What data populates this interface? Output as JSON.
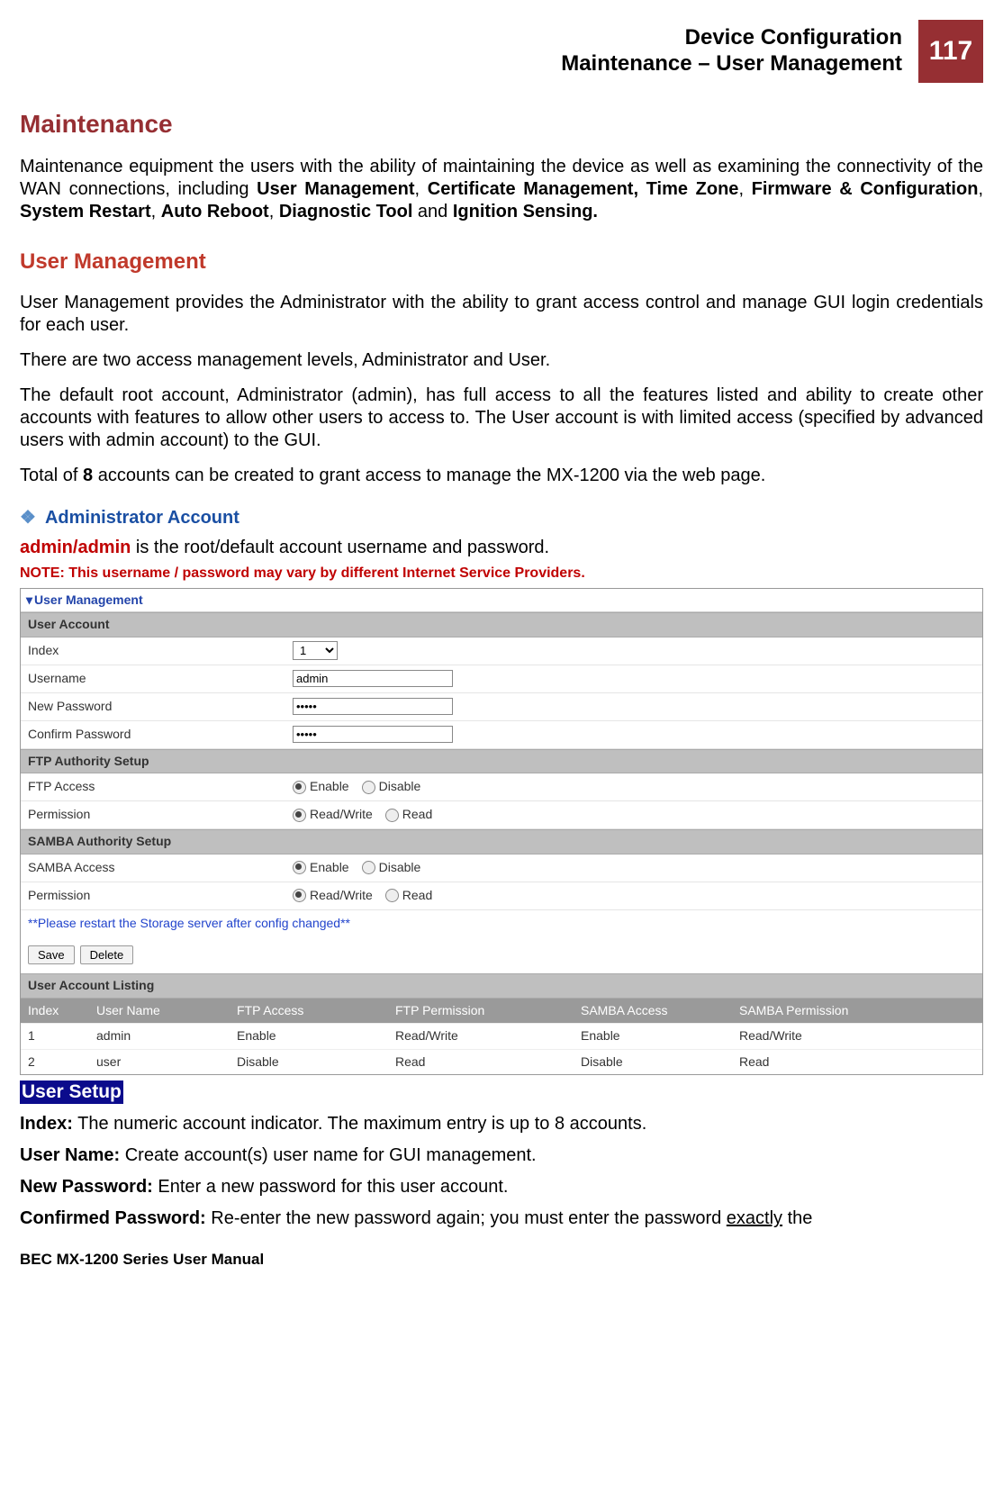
{
  "header": {
    "line1": "Device Configuration",
    "line2": "Maintenance – User Management",
    "page_number": "117"
  },
  "h1": "Maintenance",
  "intro": {
    "pre": "Maintenance equipment the users with the ability of maintaining the device as well as examining the connectivity of the WAN connections, including ",
    "b1": "User Management",
    "s1": ", ",
    "b2": "Certificate Management, Time Zone",
    "s2": ", ",
    "b3": "Firmware & Configuration",
    "s3": ", ",
    "b4": "System Restart",
    "s4": ", ",
    "b5": "Auto Reboot",
    "s5": ", ",
    "b6": "Diagnostic Tool",
    "s6": " and ",
    "b7": "Ignition Sensing."
  },
  "h2": "User Management",
  "p1": "User Management provides the Administrator with the ability to grant access control and manage GUI login credentials for each user.",
  "p2": "There are two access management levels, Administrator and User.",
  "p3": "The default root account, Administrator (admin), has full access to all the features listed and ability to create other accounts with features to allow other users to access to. The User account is with limited access (specified by advanced users with admin account) to the GUI.",
  "p4_pre": "Total of ",
  "p4_b": "8",
  "p4_post": " accounts can be created to grant access to manage the MX-1200 via the web page.",
  "admin_heading": "Administrator Account",
  "admin_line_b": "admin/admin",
  "admin_line_rest": " is the root/default account username and password.",
  "note": "NOTE: This username / password may vary by different Internet Service Providers.",
  "panel": {
    "title": "User Management",
    "sec_user_account": "User Account",
    "labels": {
      "index": "Index",
      "username": "Username",
      "new_password": "New Password",
      "confirm_password": "Confirm Password",
      "ftp_setup": "FTP Authority Setup",
      "ftp_access": "FTP Access",
      "permission": "Permission",
      "samba_setup": "SAMBA Authority Setup",
      "samba_access": "SAMBA Access"
    },
    "values": {
      "index": "1",
      "username": "admin",
      "new_password": "•••••",
      "confirm_password": "•••••"
    },
    "radio": {
      "enable": "Enable",
      "disable": "Disable",
      "readwrite": "Read/Write",
      "read": "Read"
    },
    "restart_note": "**Please restart the Storage server after config changed**",
    "buttons": {
      "save": "Save",
      "delete": "Delete"
    },
    "listing_header": "User Account Listing",
    "listing_cols": {
      "index": "Index",
      "user": "User Name",
      "ftp_access": "FTP Access",
      "ftp_perm": "FTP Permission",
      "samba_access": "SAMBA Access",
      "samba_perm": "SAMBA Permission"
    },
    "listing_rows": [
      {
        "index": "1",
        "user": "admin",
        "ftp_access": "Enable",
        "ftp_perm": "Read/Write",
        "samba_access": "Enable",
        "samba_perm": "Read/Write"
      },
      {
        "index": "2",
        "user": "user",
        "ftp_access": "Disable",
        "ftp_perm": "Read",
        "samba_access": "Disable",
        "samba_perm": "Read"
      }
    ]
  },
  "user_setup_chip": "User Setup",
  "defs": {
    "index_b": "Index:",
    "index_t": " The numeric account indicator. The maximum entry is up to 8 accounts.",
    "uname_b": "User Name:",
    "uname_t": " Create account(s) user name for GUI management.",
    "npw_b": "New Password:",
    "npw_t": " Enter a new password for this user account.",
    "cpw_b": "Confirmed Password:",
    "cpw_t1": " Re-enter the new password again; you must enter the password ",
    "cpw_u": "exactly",
    "cpw_t2": " the"
  },
  "footer": "BEC MX-1200 Series User Manual"
}
